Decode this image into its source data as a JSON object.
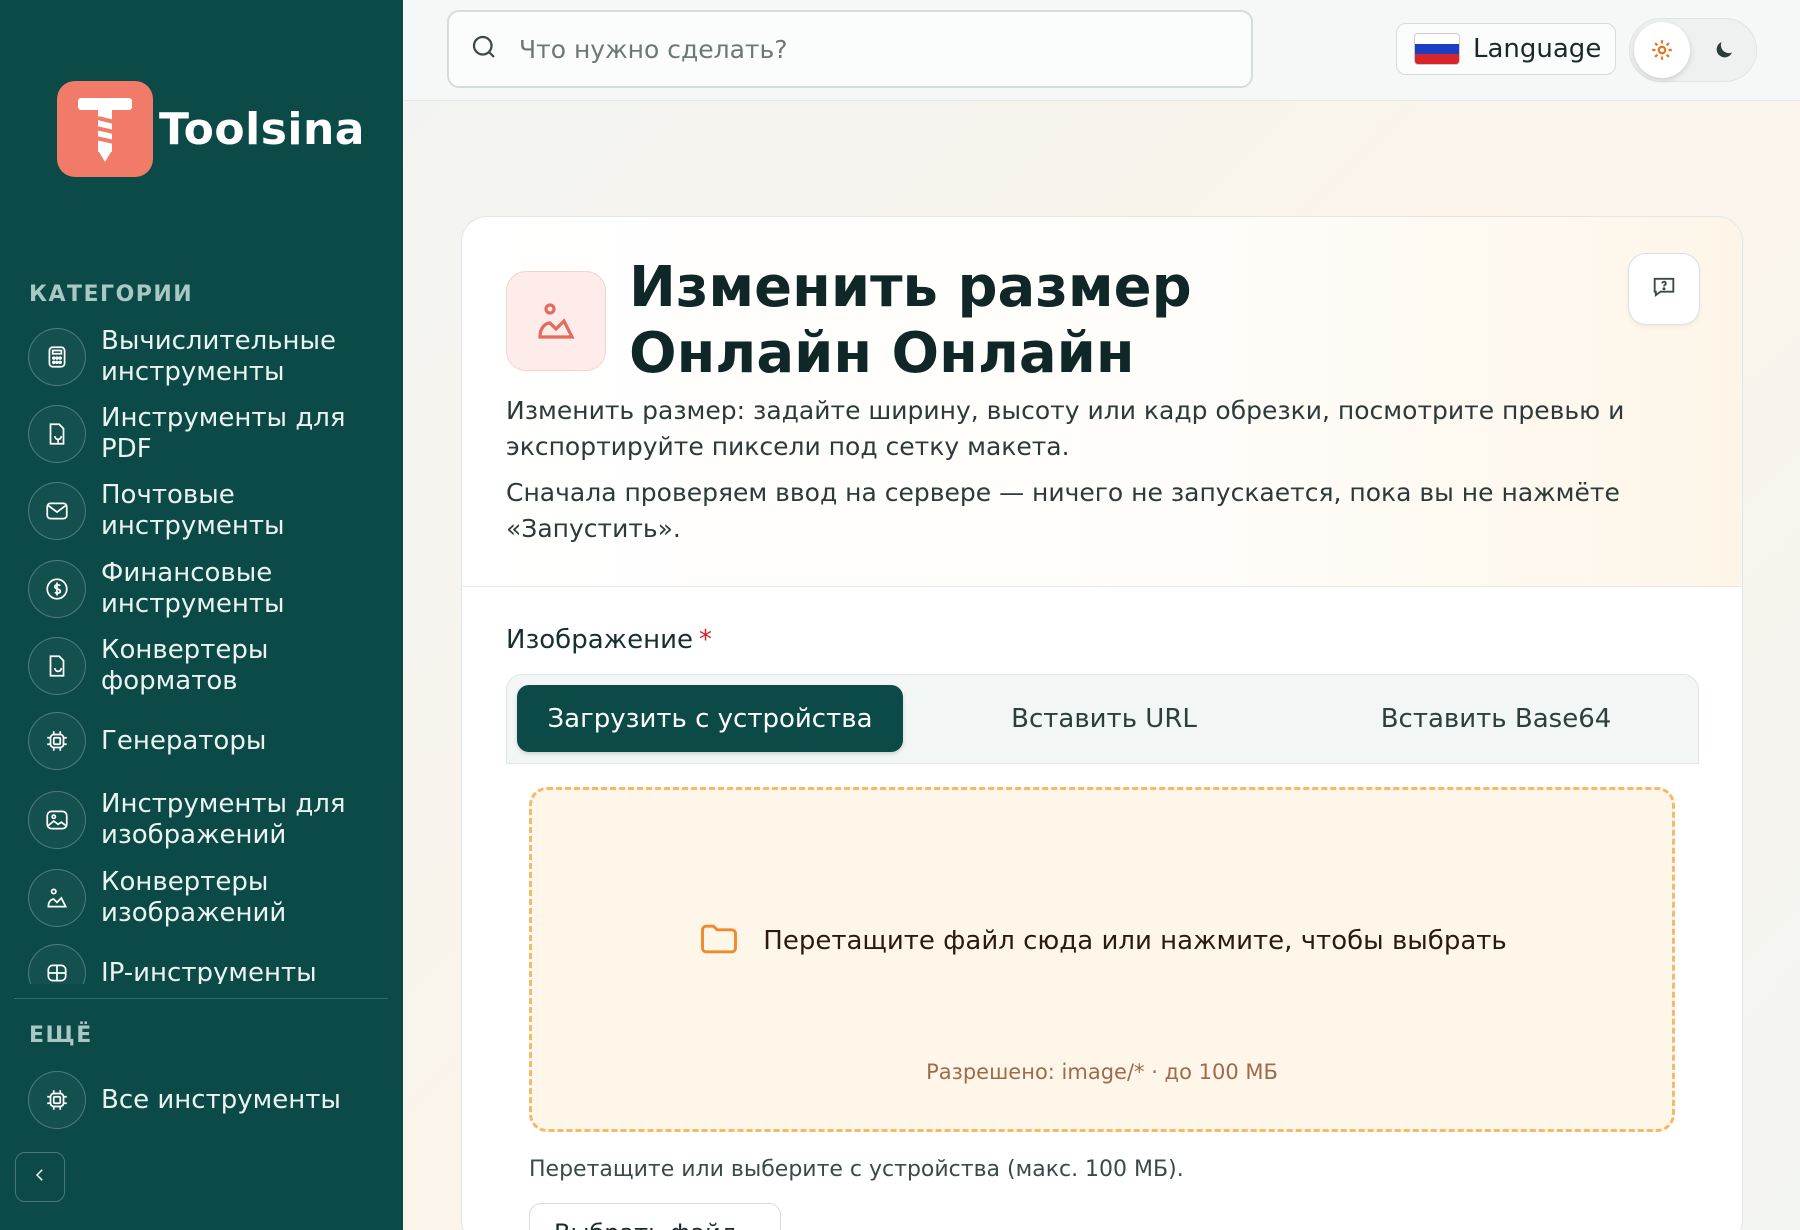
{
  "app": {
    "name": "Toolsina"
  },
  "sidebar": {
    "categories_heading": "КАТЕГОРИИ",
    "items": [
      {
        "label": "Вычислительные инструменты",
        "icon": "calculator-icon"
      },
      {
        "label": "Инструменты для PDF",
        "icon": "document-icon"
      },
      {
        "label": "Почтовые инструменты",
        "icon": "mail-icon"
      },
      {
        "label": "Финансовые инструменты",
        "icon": "dollar-icon"
      },
      {
        "label": "Конвертеры форматов",
        "icon": "file-convert-icon"
      },
      {
        "label": "Генераторы",
        "icon": "cpu-icon"
      },
      {
        "label": "Инструменты для изображений",
        "icon": "image-icon"
      },
      {
        "label": "Конвертеры изображений",
        "icon": "image-convert-icon"
      },
      {
        "label": "IP-инструменты",
        "icon": "network-icon"
      }
    ],
    "more_heading": "ЕЩЁ",
    "all_tools_label": "Все инструменты"
  },
  "topbar": {
    "search_placeholder": "Что нужно сделать?",
    "language_label": "Language"
  },
  "tool": {
    "title": "Изменить размер Онлайн Онлайн",
    "description_1": "Изменить размер: задайте ширину, высоту или кадр обрезки, посмотрите превью и экспортируйте пиксели под сетку макета.",
    "description_2": "Сначала проверяем ввод на сервере — ничего не запускается, пока вы не нажмёте «Запустить»."
  },
  "form": {
    "image_label": "Изображение",
    "required_mark": "*",
    "tabs": [
      {
        "label": "Загрузить с устройства",
        "active": true
      },
      {
        "label": "Вставить URL",
        "active": false
      },
      {
        "label": "Вставить Base64",
        "active": false
      }
    ],
    "dropzone_text": "Перетащите файл сюда или нажмите, чтобы выбрать",
    "dropzone_allowed": "Разрешено: image/* · до 100 МБ",
    "hint": "Перетащите или выберите с устройства (макс. 100 МБ).",
    "choose_button": "Выбрать файл"
  },
  "colors": {
    "sidebar_bg": "#0b4a47",
    "brand": "#f17a68",
    "dropzone_border": "#f5b96a",
    "required": "#d0202a"
  }
}
